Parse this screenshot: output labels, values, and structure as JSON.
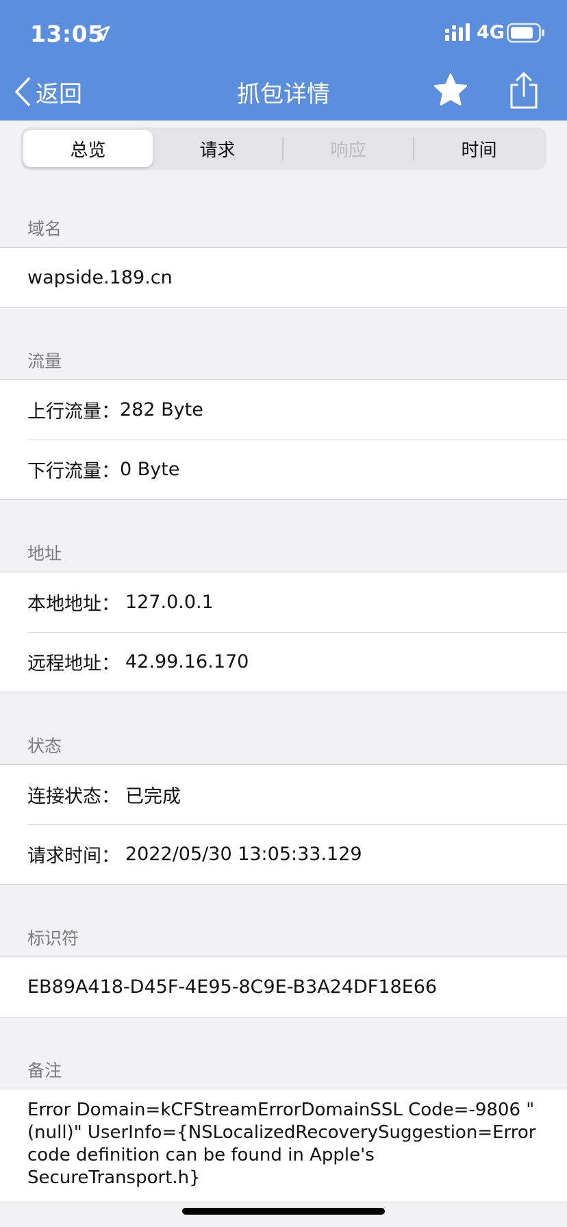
{
  "status_bar": {
    "time": "13:05",
    "network": "4G"
  },
  "nav": {
    "back_label": "返回",
    "title": "抓包详情"
  },
  "tabs": [
    {
      "label": "总览",
      "active": true,
      "disabled": false
    },
    {
      "label": "请求",
      "active": false,
      "disabled": false
    },
    {
      "label": "响应",
      "active": false,
      "disabled": true
    },
    {
      "label": "时间",
      "active": false,
      "disabled": false
    }
  ],
  "sections": {
    "domain": {
      "header": "域名",
      "value": "wapside.189.cn"
    },
    "traffic": {
      "header": "流量",
      "upload_label": "上行流量：",
      "upload_value": "282 Byte",
      "download_label": "下行流量：",
      "download_value": "0 Byte"
    },
    "address": {
      "header": "地址",
      "local_label": "本地地址：",
      "local_value": "127.0.0.1",
      "remote_label": "远程地址：",
      "remote_value": "42.99.16.170"
    },
    "status": {
      "header": "状态",
      "connection_label": "连接状态：",
      "connection_value": "已完成",
      "request_time_label": "请求时间：",
      "request_time_value": "2022/05/30 13:05:33.129"
    },
    "identifier": {
      "header": "标识符",
      "value": "EB89A418-D45F-4E95-8C9E-B3A24DF18E66"
    },
    "remark": {
      "header": "备注",
      "value": "Error Domain=kCFStreamErrorDomainSSL Code=-9806 \"(null)\" UserInfo={NSLocalizedRecoverySuggestion=Error code definition can be found in Apple's SecureTransport.h}"
    }
  },
  "colors": {
    "header_blue": "#5b8fdd",
    "page_bg": "#f2f2f4",
    "disabled_tab": "#bdbdbd"
  },
  "icons": [
    "location-arrow-icon",
    "signal-bars-icon",
    "battery-icon",
    "chevron-left-icon",
    "star-icon",
    "share-icon"
  ]
}
